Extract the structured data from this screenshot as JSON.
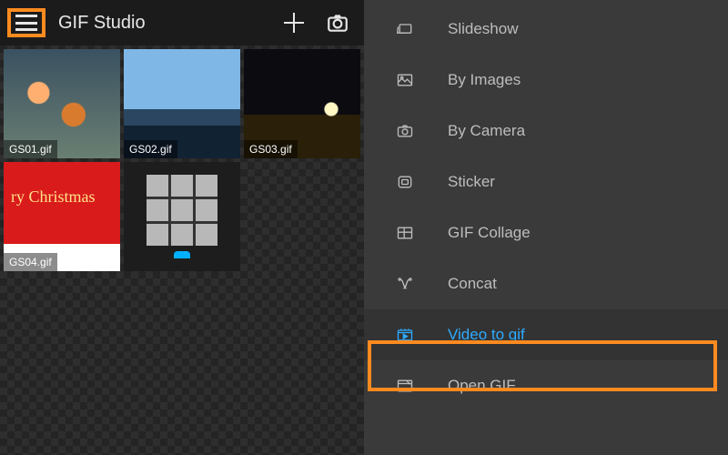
{
  "app": {
    "title": "GIF Studio"
  },
  "highlight_color": "#ff8a1f",
  "accent_color": "#2eaaff",
  "gallery": {
    "thumbs": [
      {
        "file": "GS01.gif"
      },
      {
        "file": "GS02.gif"
      },
      {
        "file": "GS03.gif"
      },
      {
        "file": "GS04.gif",
        "overlay_text": "ry Christmas"
      },
      {
        "file": ""
      }
    ]
  },
  "menu": {
    "items": [
      {
        "label": "Slideshow",
        "icon": "slideshow-icon"
      },
      {
        "label": "By Images",
        "icon": "images-icon"
      },
      {
        "label": "By Camera",
        "icon": "camera-icon"
      },
      {
        "label": "Sticker",
        "icon": "sticker-icon"
      },
      {
        "label": "GIF Collage",
        "icon": "collage-icon"
      },
      {
        "label": "Concat",
        "icon": "concat-icon"
      },
      {
        "label": "Video to gif",
        "icon": "video-icon",
        "active": true
      },
      {
        "label": "Open GIF",
        "icon": "open-icon"
      }
    ]
  }
}
